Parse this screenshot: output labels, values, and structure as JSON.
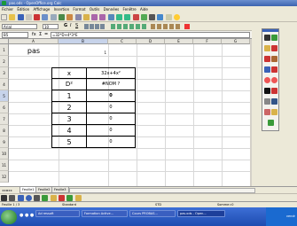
{
  "window": {
    "title": "pas.ods - OpenOffice.org Calc"
  },
  "menu": {
    "items": [
      "Fichier",
      "Édition",
      "Affichage",
      "Insertion",
      "Format",
      "Outils",
      "Données",
      "Fenêtre",
      "Aide"
    ]
  },
  "formatting": {
    "font_name": "Arial",
    "font_size": "10"
  },
  "formula_bar": {
    "name_box": "B5",
    "fx": "fx",
    "sum": "Σ",
    "equals": "=",
    "formula": "=32*D+4*3*E"
  },
  "columns": [
    "A",
    "B",
    "C",
    "D",
    "E",
    "F",
    "G",
    "H"
  ],
  "rows": [
    "1",
    "2",
    "3",
    "4",
    "5",
    "6",
    "7",
    "8",
    "9",
    "10",
    "11",
    "12"
  ],
  "sheet": {
    "a1": "pas",
    "b1": "1",
    "a3": "x",
    "b3": "32x+4x²",
    "a4": "D²",
    "b4": "#NOM ?",
    "x_values": [
      "1",
      "2",
      "3",
      "4",
      "5"
    ],
    "y_values": [
      "0",
      "0",
      "0",
      "0",
      "0"
    ]
  },
  "sheet_tabs": [
    "Feuille1",
    "Feuille2",
    "Feuille3"
  ],
  "status": {
    "sheet": "Feuille 1 / 3",
    "style": "Standard",
    "mode": "STD",
    "sum": "Somme=0"
  },
  "taskbar": {
    "tasks": [
      "Ad ressoft",
      "Formation Active...",
      "Cours PROBAS...",
      "pas.ods - Open..."
    ],
    "clock": "vendr"
  }
}
